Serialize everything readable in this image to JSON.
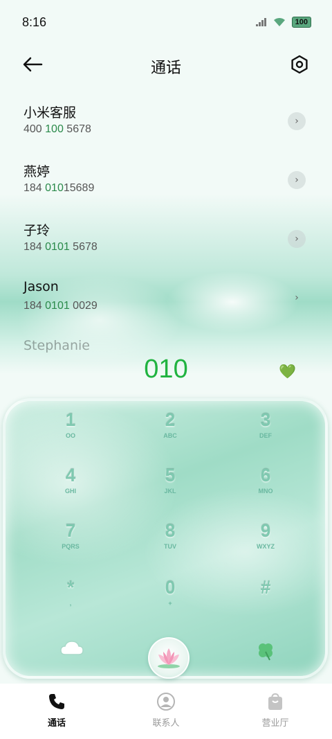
{
  "status_bar": {
    "time": "8:16",
    "battery": "100"
  },
  "header": {
    "title": "通话"
  },
  "calls": [
    {
      "name": "小米客服",
      "number_pre": "400 ",
      "number_hl": "100",
      "number_post": " 5678"
    },
    {
      "name": "燕婷",
      "number_pre": "184 ",
      "number_hl": "010",
      "number_post": "15689"
    },
    {
      "name": "子玲",
      "number_pre": "184 ",
      "number_hl": "0101",
      "number_post": " 5678"
    },
    {
      "name": "Jason",
      "number_pre": "184 ",
      "number_hl": "0101",
      "number_post": " 0029"
    },
    {
      "name": "Stephanie"
    }
  ],
  "dialer": {
    "input": "010"
  },
  "keys": [
    {
      "digit": "1",
      "letters": "OO"
    },
    {
      "digit": "2",
      "letters": "ABC"
    },
    {
      "digit": "3",
      "letters": "DEF"
    },
    {
      "digit": "4",
      "letters": "GHI"
    },
    {
      "digit": "5",
      "letters": "JKL"
    },
    {
      "digit": "6",
      "letters": "MNO"
    },
    {
      "digit": "7",
      "letters": "PQRS"
    },
    {
      "digit": "8",
      "letters": "TUV"
    },
    {
      "digit": "9",
      "letters": "WXYZ"
    },
    {
      "digit": "*",
      "letters": ","
    },
    {
      "digit": "0",
      "letters": "+"
    },
    {
      "digit": "#",
      "letters": ""
    }
  ],
  "nav": [
    {
      "label": "通话"
    },
    {
      "label": "联系人"
    },
    {
      "label": "营业厅"
    }
  ],
  "colors": {
    "accent": "#20b340",
    "highlight": "#2a8a4a"
  }
}
